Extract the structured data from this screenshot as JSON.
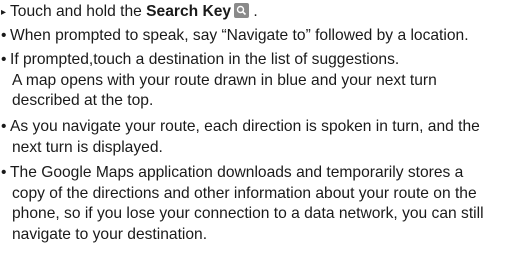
{
  "markers": {
    "arrow": "▸",
    "bullet": "•"
  },
  "item1": {
    "text_before": "Touch and hold the ",
    "bold": "Search Key",
    "text_after": " .",
    "icon": "search-key-icon"
  },
  "item2": {
    "lines": [
      "When prompted to speak, say “Navigate to” followed by a location."
    ]
  },
  "item3": {
    "lines": [
      "If prompted,touch a destination in the list of suggestions.",
      "A map opens with your route drawn in blue and your next turn",
      "described at the top."
    ]
  },
  "item4": {
    "lines": [
      "As you navigate your route, each direction is spoken in turn, and the",
      "next turn is displayed."
    ]
  },
  "item5": {
    "lines": [
      "The Google Maps application downloads and temporarily stores a",
      "copy of the directions and other information about your route on the",
      "phone, so if you lose your connection to a data network, you can still",
      "navigate to your destination."
    ]
  }
}
